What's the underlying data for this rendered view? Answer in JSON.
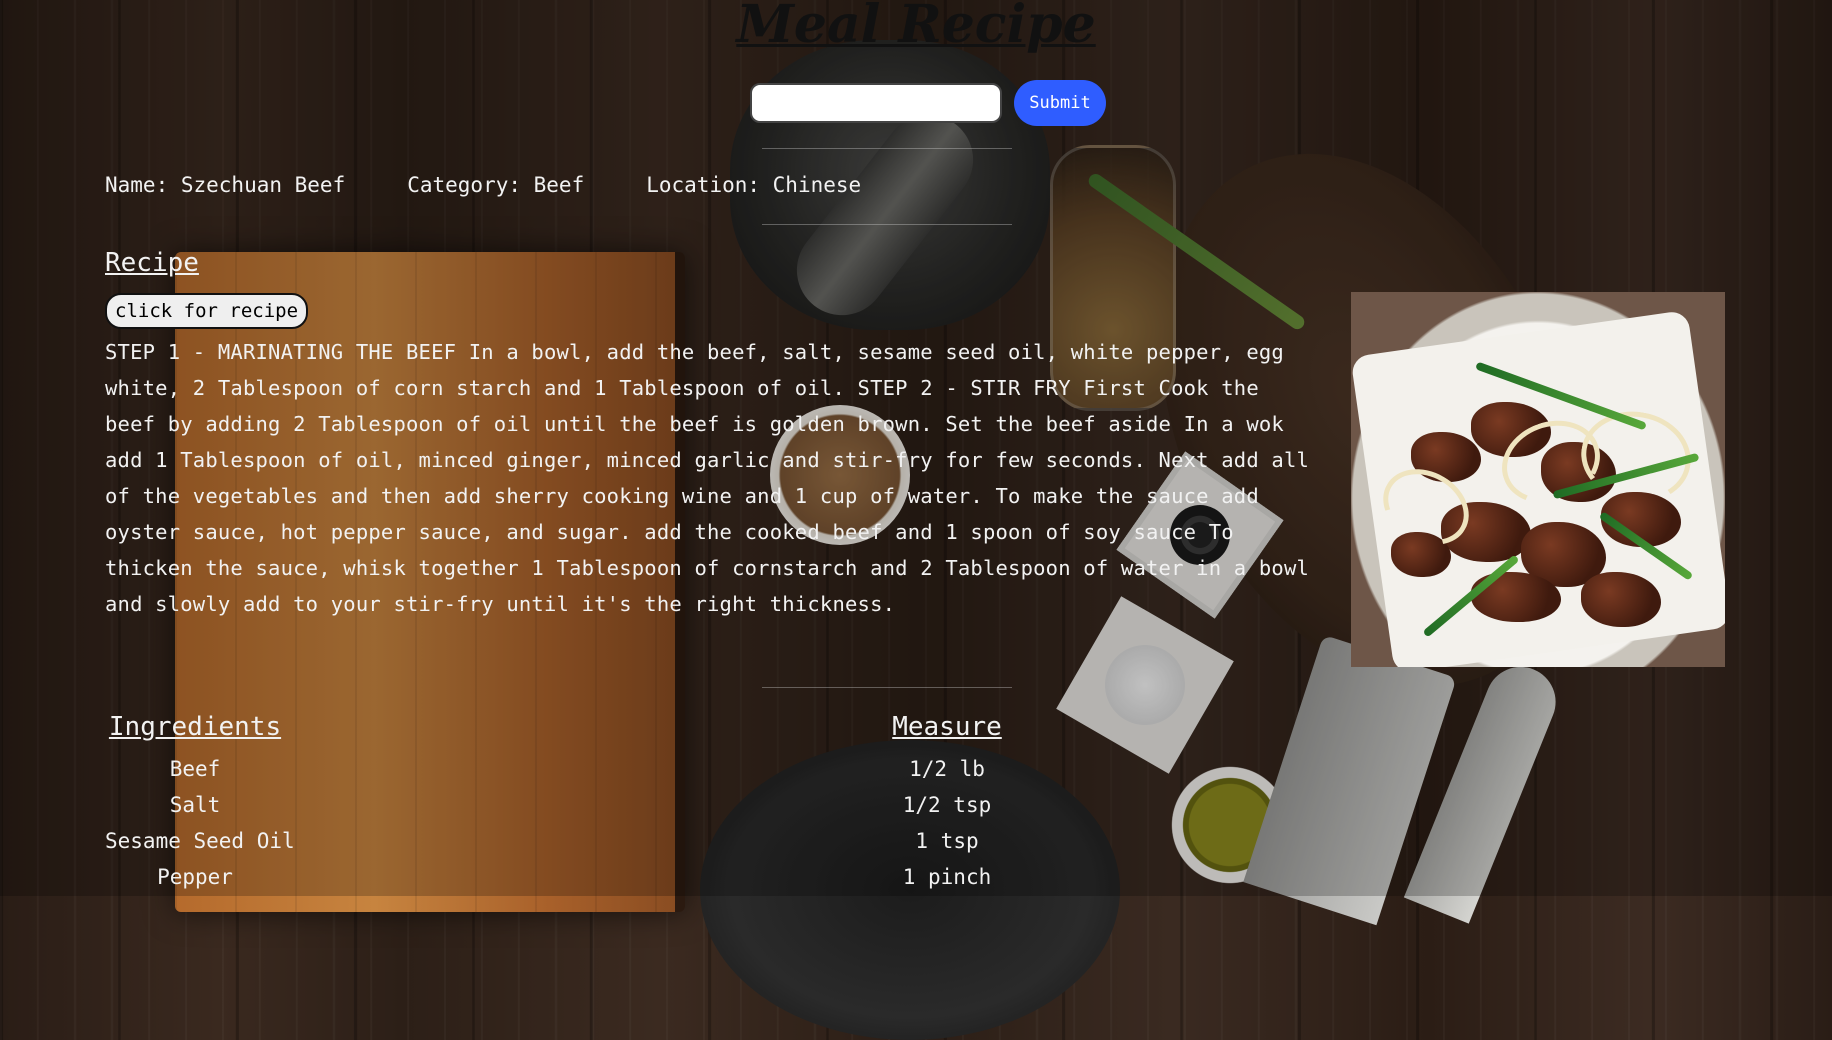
{
  "page": {
    "title": "Meal Recipe"
  },
  "search": {
    "value": "",
    "placeholder": "",
    "submit_label": "Submit"
  },
  "meal": {
    "name": "Name: Szechuan Beef",
    "category": "Category: Beef",
    "location": "Location: Chinese"
  },
  "recipe": {
    "heading": "Recipe",
    "button_label": "click for recipe",
    "instructions": "STEP 1 - MARINATING THE BEEF In a bowl, add the beef, salt, sesame seed oil, white pepper, egg white, 2 Tablespoon of corn starch and 1 Tablespoon of oil. STEP 2 - STIR FRY First Cook the beef by adding 2 Tablespoon of oil until the beef is golden brown. Set the beef aside In a wok add 1 Tablespoon of oil, minced ginger, minced garlic and stir-fry for few seconds. Next add all of the vegetables and then add sherry cooking wine and 1 cup of water. To make the sauce add oyster sauce, hot pepper sauce, and sugar. add the cooked beef and 1 spoon of soy sauce To thicken the sauce, whisk together 1 Tablespoon of cornstarch and 2 Tablespoon of water in a bowl and slowly add to your stir-fry until it's the right thickness."
  },
  "image": {
    "alt": "Szechuan Beef"
  },
  "ingredients": {
    "heading_ingredients": "Ingredients",
    "heading_measure": "Measure",
    "items": [
      {
        "ingredient": "Beef",
        "measure": "1/2 lb"
      },
      {
        "ingredient": "Salt",
        "measure": "1/2 tsp"
      },
      {
        "ingredient": "Sesame Seed Oil",
        "measure": "1 tsp"
      },
      {
        "ingredient": "Pepper",
        "measure": "1 pinch"
      }
    ]
  },
  "colors": {
    "submit": "#2f5dff",
    "title": "#111111",
    "text": "#f2f2f2"
  }
}
